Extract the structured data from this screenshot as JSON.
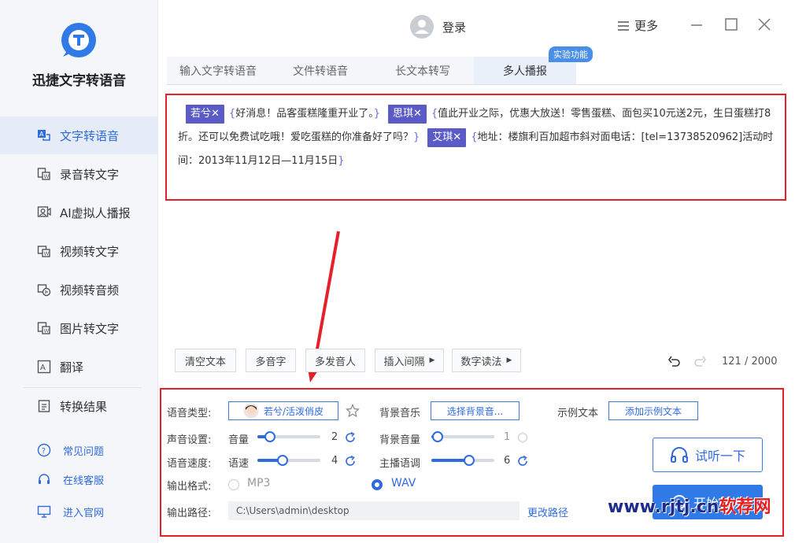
{
  "app": {
    "name": "迅捷文字转语音"
  },
  "titlebar": {
    "login_label": "登录",
    "more_label": "更多"
  },
  "sidebar": {
    "items": [
      {
        "label": "文字转语音",
        "icon": "text-to-speech-icon",
        "active": true
      },
      {
        "label": "录音转文字",
        "icon": "recording-to-text-icon"
      },
      {
        "label": "AI虚拟人播报",
        "icon": "ai-avatar-icon"
      },
      {
        "label": "视频转文字",
        "icon": "video-to-text-icon"
      },
      {
        "label": "视频转音频",
        "icon": "video-to-audio-icon"
      },
      {
        "label": "图片转文字",
        "icon": "image-to-text-icon"
      },
      {
        "label": "翻译",
        "icon": "translate-icon"
      },
      {
        "label": "转换结果",
        "icon": "results-icon"
      }
    ],
    "footer": [
      {
        "label": "常见问题",
        "icon": "question-icon"
      },
      {
        "label": "在线客服",
        "icon": "headset-icon"
      },
      {
        "label": "进入官网",
        "icon": "monitor-icon"
      }
    ]
  },
  "tabs": [
    {
      "label": "输入文字转语音"
    },
    {
      "label": "文件转语音"
    },
    {
      "label": "长文本转写"
    },
    {
      "label": "多人播报",
      "active": true
    }
  ],
  "badge": "实验功能",
  "editor": {
    "speakers": [
      "若兮✕",
      "思琪✕",
      "艾琪✕"
    ],
    "open_brace": "{",
    "close_brace": "}",
    "segments": [
      "好消息！品客蛋糕隆重开业了。",
      "值此开业之际，优惠大放送！零售蛋糕、面包买10元送2元，生日蛋糕打8折。还可以免费试吃哦！爱吃蛋糕的你准备好了吗？",
      "地址：楼旗利百加超市斜对面电话：[tel=13738520962]活动时间：2013年11月12日—11月15日"
    ],
    "count": "121 / 2000"
  },
  "toolbar": {
    "clear": "清空文本",
    "polyphone": "多音字",
    "multi_speaker": "多发音人",
    "insert_pause": "插入间隔",
    "number_reading": "数字读法"
  },
  "settings": {
    "voice_type_label": "语音类型:",
    "voice_value": "若兮/活泼俏皮",
    "bg_music_label": "背景音乐",
    "bg_music_button": "选择背景音...",
    "sample_label": "示例文本",
    "sample_button": "添加示例文本",
    "sound_label": "声音设置:",
    "volume_label": "音量",
    "volume_value": "2",
    "bg_volume_label": "背景音量",
    "bg_volume_value": "1",
    "speed_label": "语音速度:",
    "rate_label": "语速",
    "rate_value": "4",
    "pitch_label": "主播语调",
    "pitch_value": "6",
    "format_label": "输出格式:",
    "format_mp3": "MP3",
    "format_wav": "WAV",
    "selected_format": "WAV",
    "path_label": "输出路径:",
    "path_value": "C:\\Users\\admin\\desktop",
    "change_path": "更改路径",
    "listen_button": "试听一下",
    "start_button": "开始转换",
    "volume_level": 0.2,
    "bg_volume_level": 0.1,
    "rate_level": 0.4,
    "pitch_level": 0.6
  },
  "watermark": {
    "latin": "www.rjtj.cn",
    "cn": "软荐网"
  },
  "colors": {
    "accent": "#2f6bde",
    "speaker_tag": "#5b5bc7",
    "highlight": "#e5202a"
  }
}
